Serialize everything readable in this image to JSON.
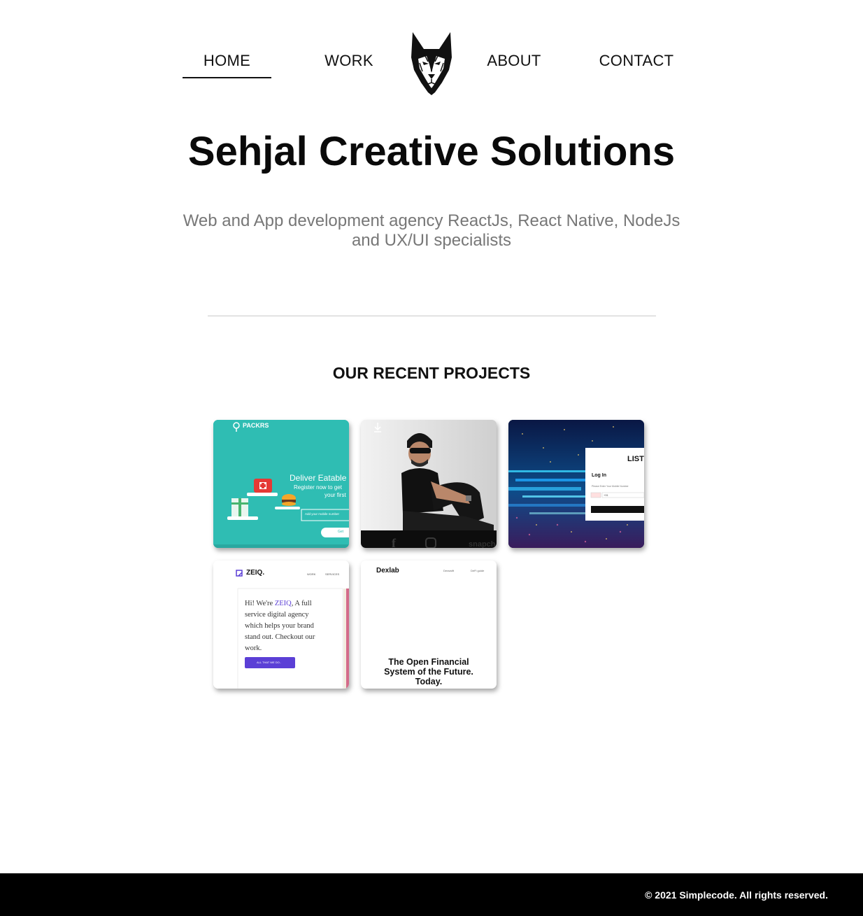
{
  "nav": {
    "items": [
      {
        "label": "HOME",
        "active": true
      },
      {
        "label": "WORK",
        "active": false
      },
      {
        "label": "ABOUT",
        "active": false
      },
      {
        "label": "CONTACT",
        "active": false
      }
    ],
    "logo_icon": "wolf-head-icon"
  },
  "hero": {
    "title": "Sehjal Creative Solutions",
    "subtitle_line1": "Web and App development agency ReactJs, React Native, NodeJs",
    "subtitle_line2": "and UX/UI specialists"
  },
  "projects": {
    "heading": "OUR RECENT PROJECTS",
    "cards": [
      {
        "brand": "PACKRS",
        "headline": "Deliver Eatable",
        "line1": "Register now to get",
        "line2": "your first",
        "input_placeholder": "Add your mobile number",
        "button": "Get",
        "accent": "#2fbdb3"
      },
      {
        "footer_text": "snapch",
        "icons": [
          "download-icon",
          "facebook-icon",
          "instagram-icon"
        ]
      },
      {
        "brand": "LIST",
        "form_title": "Log In",
        "form_hint": "Please Enter Your Mobile Number",
        "code": "+91"
      },
      {
        "brand": "ZEIQ.",
        "nav1": "WORK",
        "nav2": "SERVICES",
        "text_pre": "Hi! We're ",
        "text_brand": "ZEIQ",
        "text_post1": ", A full",
        "text_line2": "service digital agency",
        "text_line3": "which helps your brand",
        "text_line4": "stand out. Checkout our",
        "text_line5": "work.",
        "button": "ALL THAT WE DO..",
        "accent": "#5b3fd6"
      },
      {
        "brand": "Dexlab",
        "nav1": "Dexswift",
        "nav2": "DeFi guide",
        "line1": "The Open Financial",
        "line2": "System of the Future.",
        "line3": "Today."
      }
    ]
  },
  "footer": {
    "copyright": "© 2021 Simplecode. All rights reserved."
  }
}
